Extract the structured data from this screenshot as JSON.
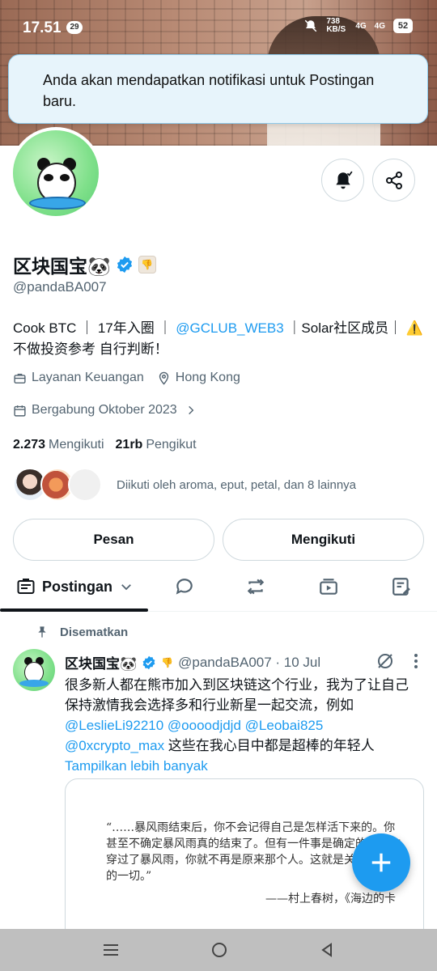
{
  "status_bar": {
    "time": "17.51",
    "notif_count": "29",
    "speed": "738 KB/S",
    "network1": "4G",
    "network2": "4G",
    "battery": "52"
  },
  "toast": {
    "text": "Anda akan mendapatkan notifikasi untuk Postingan baru."
  },
  "profile": {
    "name": "区块国宝🐼",
    "handle": "@pandaBA007",
    "bio_part1": "Cook BTC ｜ 17年入圈 ｜ ",
    "bio_link": "@GCLUB_WEB3",
    "bio_part2": " ｜Solar社区成员｜ ⚠️不做投资参考 自行判断！",
    "category": "Layanan Keuangan",
    "location": "Hong Kong",
    "joined": "Bergabung Oktober 2023",
    "following_count": "2.273",
    "following_label": "Mengikuti",
    "followers_count": "21rb",
    "followers_label": "Pengikut",
    "followed_by": "Diikuti oleh aroma, eput, petal, dan 8 lainnya"
  },
  "actions": {
    "message": "Pesan",
    "following": "Mengikuti"
  },
  "tabs": {
    "active": "Postingan"
  },
  "pinned_post": {
    "pinned_label": "Disematkan",
    "name": "区块国宝🐼",
    "meta": "@pandaBA007 · 10 Jul",
    "text_part1": "很多新人都在熊市加入到区块链这个行业，我为了让自己保持激情我会选择多和行业新星一起交流，例如 ",
    "mention1": "@LeslieLi92210",
    "mention2": "@oooodjdjd",
    "mention3": "@Leobai825",
    "mention4": "@0xcrypto_max",
    "text_part2": " 这些在我心目中都是超棒的年轻人",
    "show_more": "Tampilkan lebih banyak",
    "quote_text": "“……暴风雨结束后，你不会记得自己是怎样活下来的。你甚至不确定暴风雨真的结束了。但有一件事是确定的：当你穿过了暴风雨，你就不再是原来那个人。这就是关于暴风雨的一切。”",
    "quote_author": "——村上春树，《海边的卡"
  },
  "colors": {
    "accent": "#1d9bf0",
    "text": "#0f1419",
    "muted": "#536471",
    "toast_bg": "#e7f4fb"
  }
}
